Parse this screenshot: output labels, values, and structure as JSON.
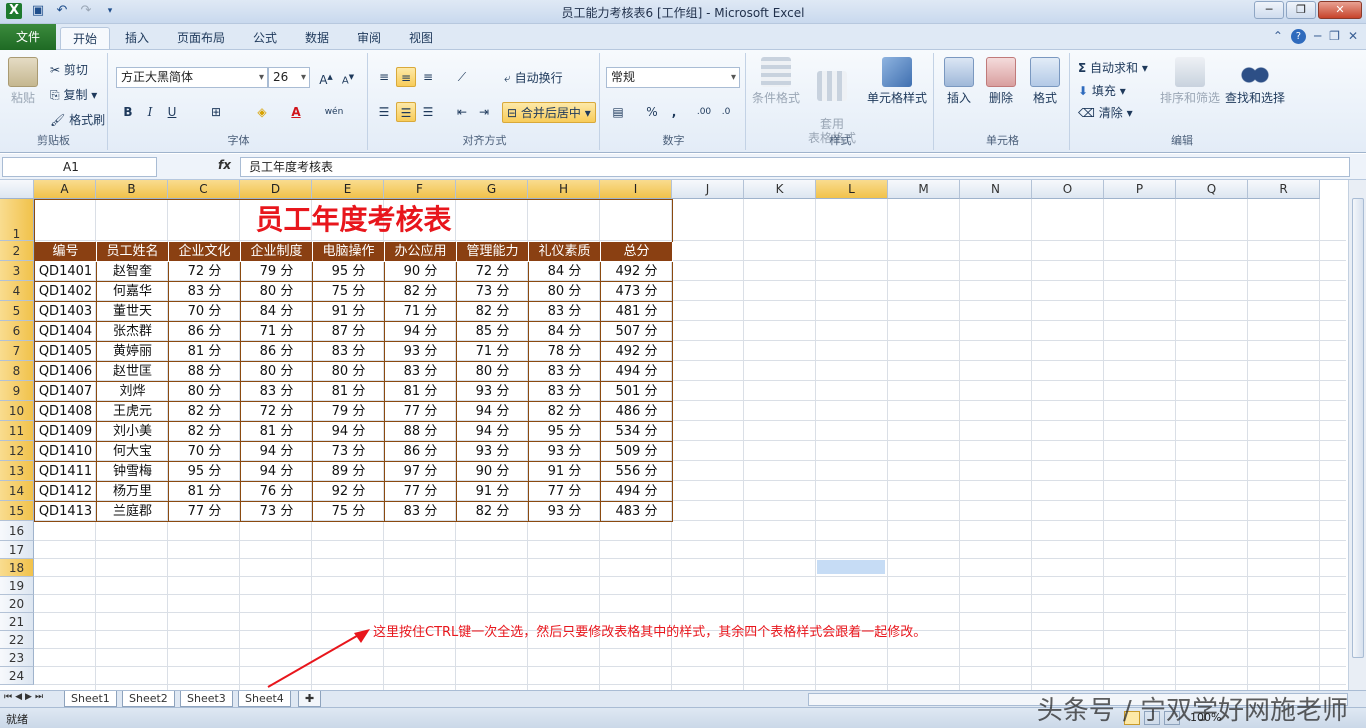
{
  "window": {
    "title": "员工能力考核表6  [工作组]  -  Microsoft Excel"
  },
  "tabs": [
    "文件",
    "开始",
    "插入",
    "页面布局",
    "公式",
    "数据",
    "审阅",
    "视图"
  ],
  "ribbon": {
    "clipboard": {
      "paste": "粘贴",
      "cut": "剪切",
      "copy": "复制",
      "format_painter": "格式刷",
      "label": "剪贴板"
    },
    "font": {
      "name": "方正大黑简体",
      "size": "26",
      "label": "字体",
      "bold": "B",
      "italic": "I",
      "underline": "U"
    },
    "alignment": {
      "wrap": "自动换行",
      "merge": "合并后居中",
      "label": "对齐方式"
    },
    "number": {
      "format": "常规",
      "percent": "%",
      "comma": ",",
      "label": "数字"
    },
    "styles": {
      "conditional": "条件格式",
      "table": "套用\n表格格式",
      "cell_styles": "单元格样式",
      "label": "样式"
    },
    "cells": {
      "insert": "插入",
      "delete": "删除",
      "format": "格式",
      "label": "单元格"
    },
    "editing": {
      "autosum": "自动求和",
      "fill": "填充",
      "clear": "清除",
      "sort": "排序和筛选",
      "find": "查找和选择",
      "label": "编辑"
    }
  },
  "formula_bar": {
    "name_box": "A1",
    "fx": "fx",
    "content": "员工年度考核表"
  },
  "columns": [
    "A",
    "B",
    "C",
    "D",
    "E",
    "F",
    "G",
    "H",
    "I",
    "J",
    "K",
    "L",
    "M",
    "N",
    "O",
    "P",
    "Q",
    "R"
  ],
  "rows": [
    "1",
    "2",
    "3",
    "4",
    "5",
    "6",
    "7",
    "8",
    "9",
    "10",
    "11",
    "12",
    "13",
    "14",
    "15",
    "16",
    "17",
    "18",
    "19",
    "20",
    "21",
    "22",
    "23",
    "24"
  ],
  "table": {
    "title": "员工年度考核表",
    "headers": [
      "编号",
      "员工姓名",
      "企业文化",
      "企业制度",
      "电脑操作",
      "办公应用",
      "管理能力",
      "礼仪素质",
      "总分"
    ],
    "rows": [
      [
        "QD1401",
        "赵智奎",
        "72 分",
        "79 分",
        "95 分",
        "90 分",
        "72 分",
        "84 分",
        "492 分"
      ],
      [
        "QD1402",
        "何嘉华",
        "83 分",
        "80 分",
        "75 分",
        "82 分",
        "73 分",
        "80 分",
        "473 分"
      ],
      [
        "QD1403",
        "董世天",
        "70 分",
        "84 分",
        "91 分",
        "71 分",
        "82 分",
        "83 分",
        "481 分"
      ],
      [
        "QD1404",
        "张杰群",
        "86 分",
        "71 分",
        "87 分",
        "94 分",
        "85 分",
        "84 分",
        "507 分"
      ],
      [
        "QD1405",
        "黄婷丽",
        "81 分",
        "86 分",
        "83 分",
        "93 分",
        "71 分",
        "78 分",
        "492 分"
      ],
      [
        "QD1406",
        "赵世匡",
        "88 分",
        "80 分",
        "80 分",
        "83 分",
        "80 分",
        "83 分",
        "494 分"
      ],
      [
        "QD1407",
        "刘烨",
        "80 分",
        "83 分",
        "81 分",
        "81 分",
        "93 分",
        "83 分",
        "501 分"
      ],
      [
        "QD1408",
        "王虎元",
        "82 分",
        "72 分",
        "79 分",
        "77 分",
        "94 分",
        "82 分",
        "486 分"
      ],
      [
        "QD1409",
        "刘小美",
        "82 分",
        "81 分",
        "94 分",
        "88 分",
        "94 分",
        "95 分",
        "534 分"
      ],
      [
        "QD1410",
        "何大宝",
        "70 分",
        "94 分",
        "73 分",
        "86 分",
        "93 分",
        "93 分",
        "509 分"
      ],
      [
        "QD1411",
        "钟雪梅",
        "95 分",
        "94 分",
        "89 分",
        "97 分",
        "90 分",
        "91 分",
        "556 分"
      ],
      [
        "QD1412",
        "杨万里",
        "81 分",
        "76 分",
        "92 分",
        "77 分",
        "91 分",
        "77 分",
        "494 分"
      ],
      [
        "QD1413",
        "兰庭郡",
        "77 分",
        "73 分",
        "75 分",
        "83 分",
        "82 分",
        "93 分",
        "483 分"
      ]
    ]
  },
  "annotation": "这里按住CTRL键一次全选，然后只要修改表格其中的样式，其余四个表格样式会跟着一起修改。",
  "sheets": [
    "Sheet1",
    "Sheet2",
    "Sheet3",
    "Sheet4"
  ],
  "status": {
    "ready": "就绪",
    "zoom": "100%"
  },
  "watermark": "头条号 / 宁双学好网施老师",
  "colors": {
    "accent": "#8a4012",
    "title_red": "#e8161c",
    "file_tab": "#2a7a30"
  }
}
